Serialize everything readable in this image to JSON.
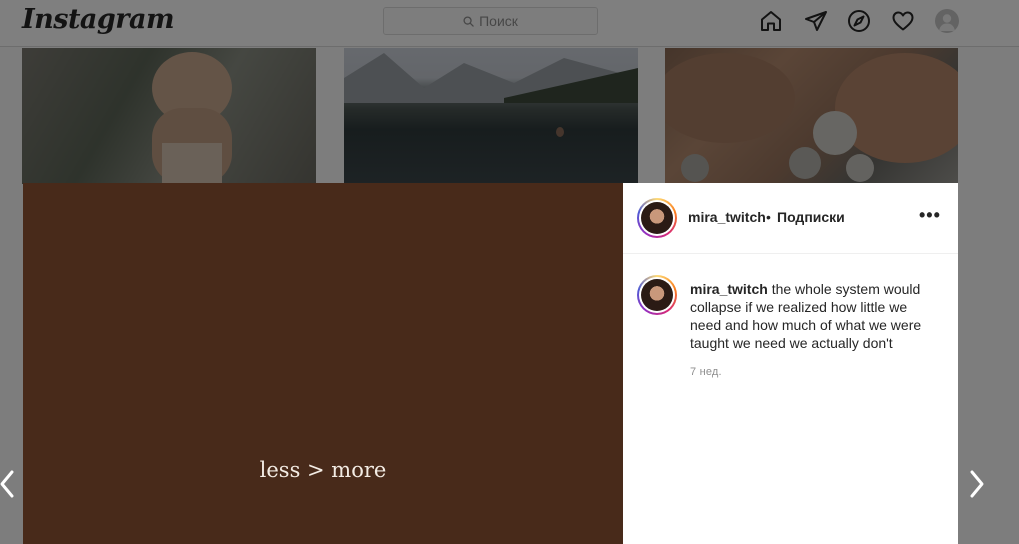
{
  "header": {
    "logo": "Instagram",
    "search_placeholder": "Поиск",
    "icons": [
      "home-icon",
      "direct-icon",
      "explore-icon",
      "heart-icon",
      "profile-avatar"
    ]
  },
  "post": {
    "media_text": "less > more",
    "author": {
      "username": "mira_twitch",
      "separator": "•",
      "follow_label": "Подписки"
    },
    "more_label": "•••",
    "comment": {
      "username": "mira_twitch",
      "text": "the whole system would collapse if we realized how little we need and how much of what we were taught we need we actually don't"
    },
    "time": "7 нед."
  },
  "colors": {
    "media_background": "#482a1a",
    "overlay": "rgba(0,0,0,0.5)"
  }
}
